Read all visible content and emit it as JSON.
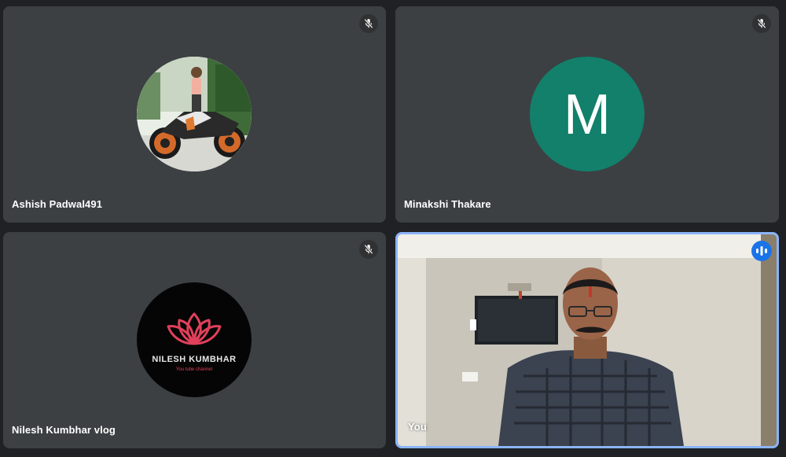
{
  "participants": [
    {
      "name": "Ashish Padwal491",
      "avatar_type": "photo",
      "avatar_description_icon": "person-on-motorcycle-photo",
      "mic_icon": "mic-off-icon"
    },
    {
      "name": "Minakshi Thakare",
      "avatar_type": "letter",
      "avatar_letter": "M",
      "avatar_color": "#12806a",
      "mic_icon": "mic-off-icon"
    },
    {
      "name": "Nilesh Kumbhar vlog",
      "avatar_type": "logo",
      "logo_title": "NILESH KUMBHAR",
      "logo_subtitle": "You tube channel",
      "logo_icon": "lotus-icon",
      "mic_icon": "mic-off-icon"
    },
    {
      "name": "You",
      "avatar_type": "video",
      "speaking_icon": "audio-level-icon",
      "active_speaker_border": "#8ab4f8"
    }
  ],
  "colors": {
    "background": "#202124",
    "tile": "#3c4043",
    "speaking_badge": "#1a73e8"
  }
}
